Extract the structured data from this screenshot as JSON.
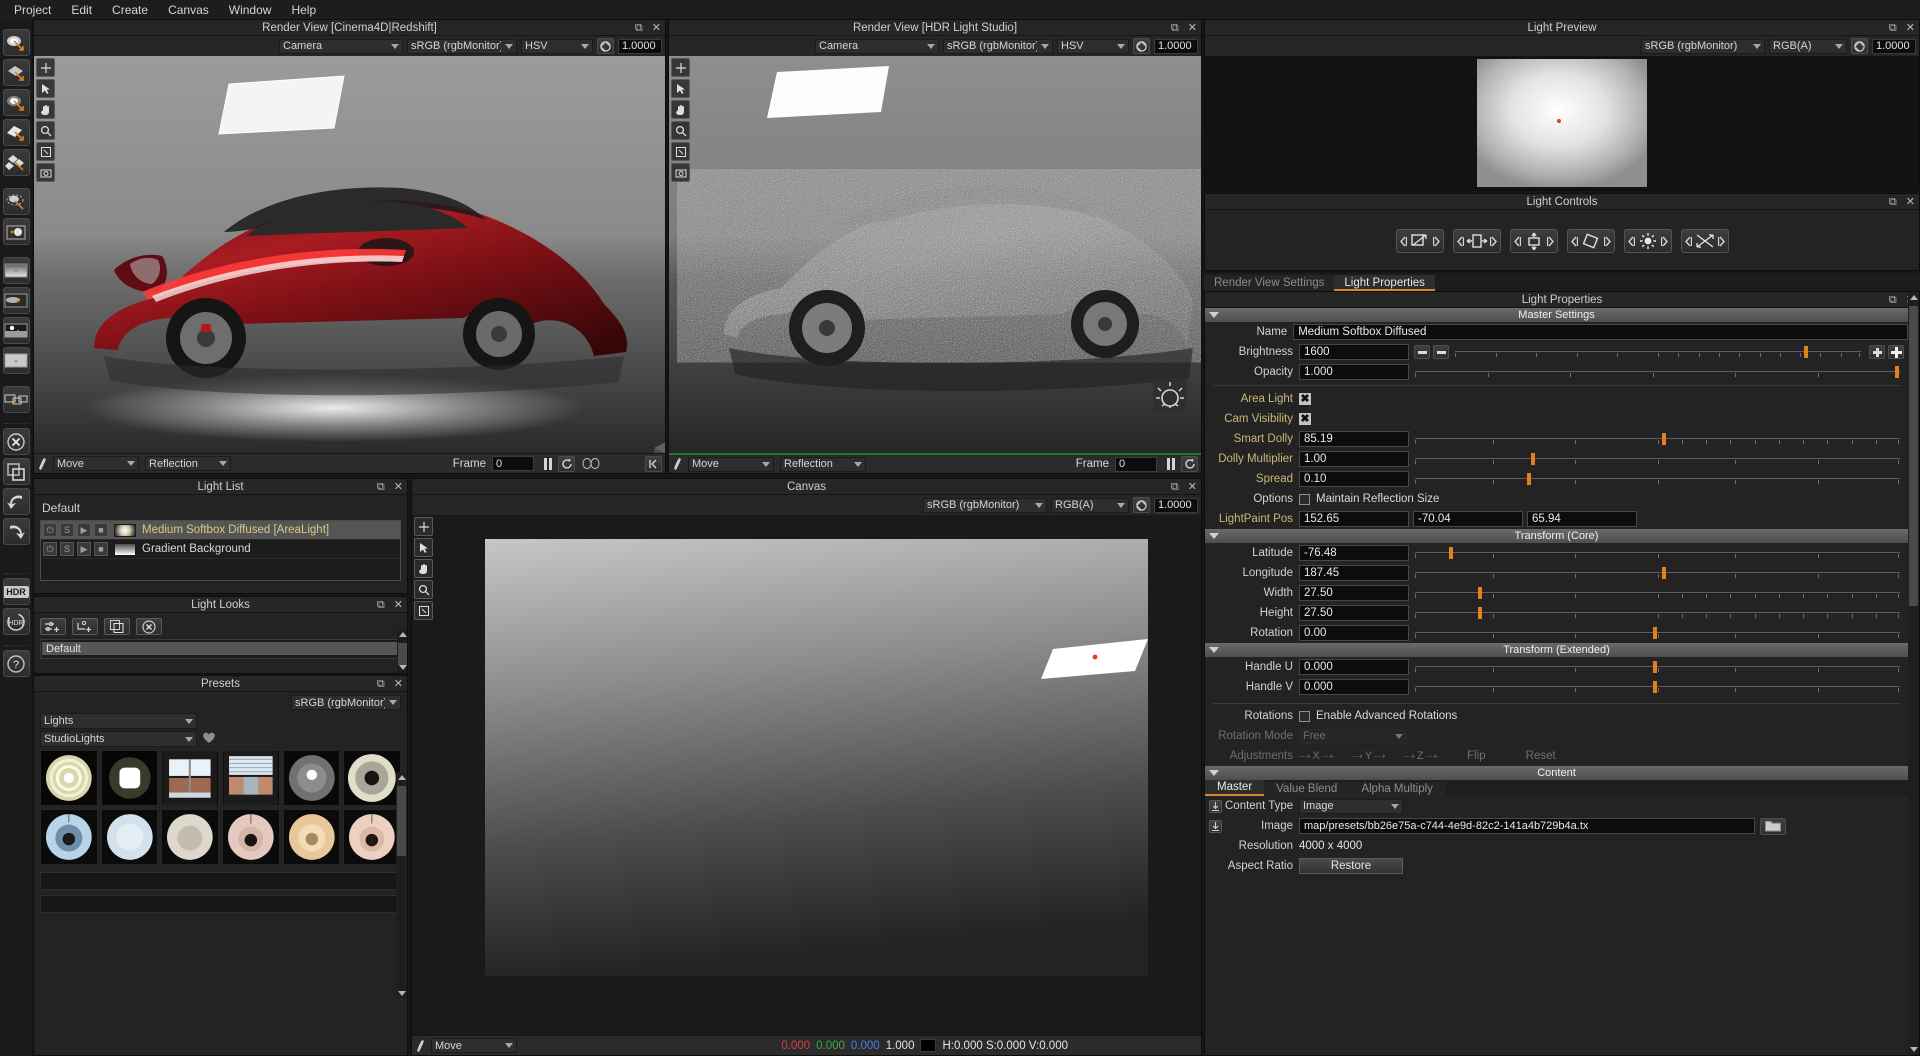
{
  "menu": {
    "items": [
      "Project",
      "Edit",
      "Create",
      "Canvas",
      "Window",
      "Help"
    ]
  },
  "rail": {
    "tools": [
      {
        "name": "light-paint-area-icon"
      },
      {
        "name": "light-paint-plane-icon"
      },
      {
        "name": "light-paint-soft-icon"
      },
      {
        "name": "light-paint-card-icon"
      },
      {
        "name": "light-paint-multi-icon"
      },
      {
        "name": "light-paint-rotate-icon"
      },
      {
        "name": "light-paint-sun-icon"
      },
      {
        "name": "gradient-background-icon"
      },
      {
        "name": "hdri-background-icon"
      },
      {
        "name": "horizon-background-icon"
      },
      {
        "name": "flat-background-icon"
      },
      {
        "name": "layers-icon"
      },
      {
        "name": "delete-icon"
      },
      {
        "name": "duplicate-icon"
      },
      {
        "name": "undo-icon"
      },
      {
        "name": "redo-icon"
      },
      {
        "name": "hdr-icon"
      },
      {
        "name": "hdr-refresh-icon"
      },
      {
        "name": "help-icon"
      }
    ]
  },
  "render_view_1": {
    "title": "Render View [Cinema4D|Redshift]",
    "camera": "Camera",
    "colorspace": "sRGB (rgbMonitor)",
    "channel": "HSV",
    "exposure": "1.0000",
    "mode": "Move",
    "surface": "Reflection",
    "frame_label": "Frame",
    "frame_value": "0"
  },
  "render_view_2": {
    "title": "Render View [HDR Light Studio]",
    "camera": "Camera",
    "colorspace": "sRGB (rgbMonitor)",
    "channel": "HSV",
    "exposure": "1.0000",
    "mode": "Move",
    "surface": "Reflection",
    "frame_label": "Frame",
    "frame_value": "0"
  },
  "light_preview": {
    "title": "Light Preview",
    "colorspace": "sRGB (rgbMonitor)",
    "channel": "RGB(A)",
    "exposure": "1.0000"
  },
  "light_controls": {
    "title": "Light Controls",
    "buttons": [
      "scale-uniform-icon",
      "scale-width-icon",
      "scale-height-icon",
      "rotate-icon",
      "brightness-icon",
      "move-diagonal-icon"
    ]
  },
  "light_list": {
    "title": "Light List",
    "group": "Default",
    "rows": [
      {
        "name": "Medium Softbox Diffused [AreaLight]",
        "selected": true
      },
      {
        "name": "Gradient Background",
        "selected": false
      }
    ]
  },
  "light_looks": {
    "title": "Light Looks",
    "buttons": [
      "add-look-icon",
      "add-sub-look-icon",
      "copy-look-icon",
      "delete-look-icon"
    ],
    "items": [
      "Default"
    ]
  },
  "presets": {
    "title": "Presets",
    "colorspace": "sRGB (rgbMonitor)",
    "category": "Lights",
    "subcategory": "StudioLights",
    "favourite_icon": "heart-icon",
    "thumb_count": 12
  },
  "canvas": {
    "title": "Canvas",
    "colorspace": "sRGB (rgbMonitor)",
    "channel": "RGB(A)",
    "exposure": "1.0000",
    "mode": "Move",
    "rgb_r": "0.000",
    "rgb_g": "0.000",
    "rgb_b": "0.000",
    "alpha": "1.000",
    "hsv": "H:0.000 S:0.000 V:0.000"
  },
  "properties": {
    "tabs": [
      {
        "label": "Render View Settings",
        "active": false
      },
      {
        "label": "Light Properties",
        "active": true
      }
    ],
    "panel_title": "Light Properties",
    "sections": {
      "master": "Master Settings",
      "transform_core": "Transform (Core)",
      "transform_ext": "Transform (Extended)",
      "content": "Content"
    },
    "fields": {
      "name_label": "Name",
      "name_value": "Medium Softbox Diffused",
      "brightness_label": "Brightness",
      "brightness_value": "1600",
      "opacity_label": "Opacity",
      "opacity_value": "1.000",
      "area_light_label": "Area Light",
      "cam_visibility_label": "Cam Visibility",
      "smart_dolly_label": "Smart Dolly",
      "smart_dolly_value": "85.19",
      "dolly_mult_label": "Dolly Multiplier",
      "dolly_mult_value": "1.00",
      "spread_label": "Spread",
      "spread_value": "0.10",
      "options_label": "Options",
      "options_checkbox": "Maintain Reflection Size",
      "lightpaint_label": "LightPaint Pos",
      "lightpaint_x": "152.65",
      "lightpaint_y": "-70.04",
      "lightpaint_z": "65.94",
      "latitude_label": "Latitude",
      "latitude_value": "-76.48",
      "longitude_label": "Longitude",
      "longitude_value": "187.45",
      "width_label": "Width",
      "width_value": "27.50",
      "height_label": "Height",
      "height_value": "27.50",
      "rotation_label": "Rotation",
      "rotation_value": "0.00",
      "handle_u_label": "Handle U",
      "handle_u_value": "0.000",
      "handle_v_label": "Handle V",
      "handle_v_value": "0.000",
      "rotations_label": "Rotations",
      "rotations_checkbox": "Enable Advanced Rotations",
      "rotation_mode_label": "Rotation Mode",
      "rotation_mode_value": "Free",
      "adjustments_label": "Adjustments",
      "adj_x": "X",
      "adj_y": "Y",
      "adj_z": "Z",
      "adj_flip": "Flip",
      "adj_reset": "Reset",
      "content_tabs": [
        "Master",
        "Value Blend",
        "Alpha Multiply"
      ],
      "content_type_label": "Content Type",
      "content_type_value": "Image",
      "image_label": "Image",
      "image_value": "map/presets/bb26e75a-c744-4e9d-82c2-141a4b729b4a.tx",
      "resolution_label": "Resolution",
      "resolution_value": "4000 x 4000",
      "aspect_label": "Aspect Ratio",
      "aspect_button": "Restore"
    },
    "slider_positions": {
      "brightness": 86,
      "opacity": 99,
      "smart_dolly": 51,
      "dolly_multiplier": 24,
      "spread": 23,
      "latitude": 7,
      "longitude": 51,
      "width": 13,
      "height": 13,
      "rotation": 49,
      "handle_u": 49,
      "handle_v": 49
    }
  },
  "colors": {
    "accent": "#e2801c",
    "panel_bg": "#232323",
    "gold_label": "#c9b878",
    "highlight": "#d6c98a"
  }
}
